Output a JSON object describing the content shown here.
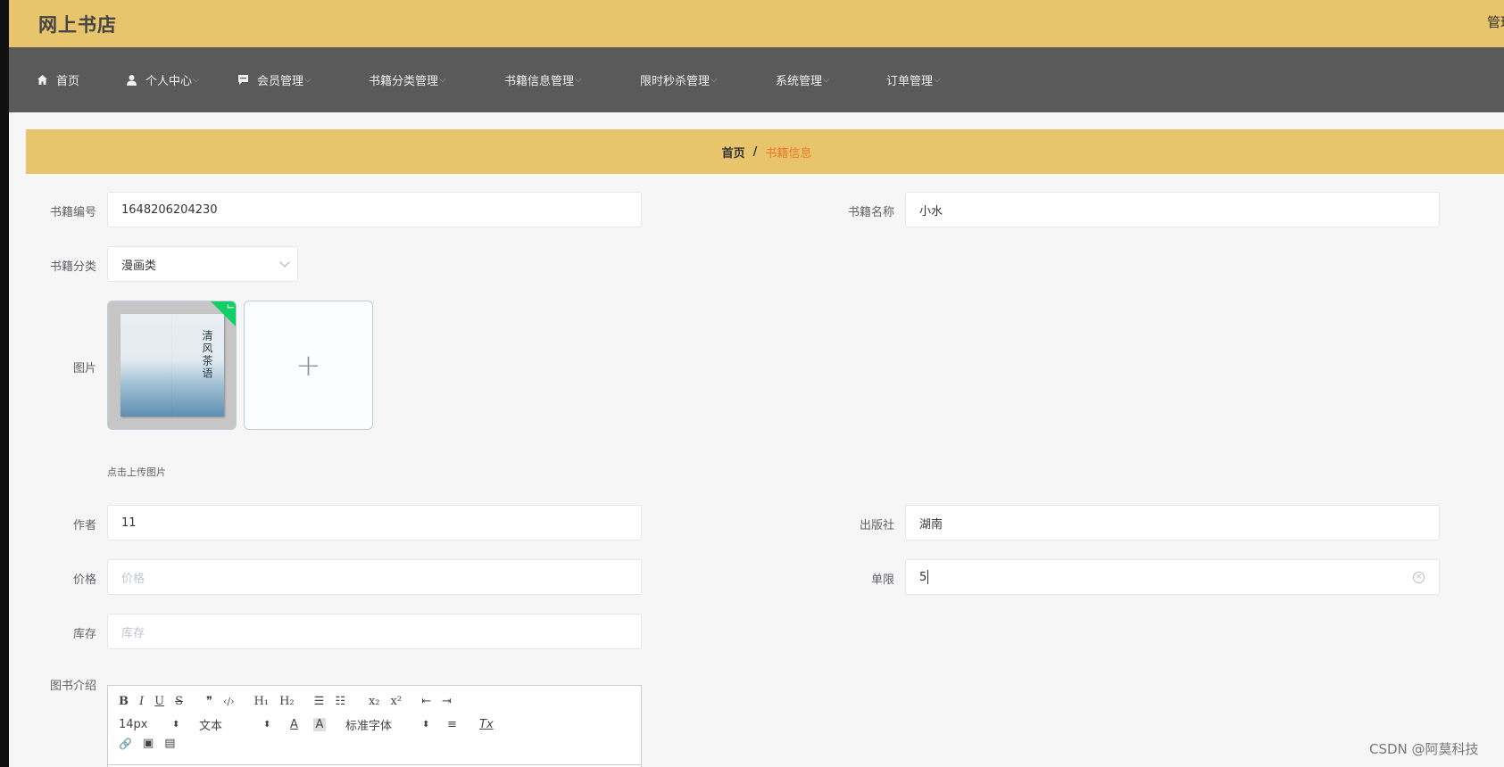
{
  "header": {
    "brand": "网上书店",
    "right_text": "管理"
  },
  "nav": [
    {
      "label": "首页",
      "icon": "home-icon",
      "chevron": ""
    },
    {
      "label": "个人中心",
      "icon": "user-icon",
      "chevron": "⌵"
    },
    {
      "label": "会员管理",
      "icon": "chat-icon",
      "chevron": "⌵"
    },
    {
      "label": "书籍分类管理",
      "icon": "grid-icon",
      "chevron": "⌵"
    },
    {
      "label": "书籍信息管理",
      "icon": "grid-icon",
      "chevron": "⌵"
    },
    {
      "label": "限时秒杀管理",
      "icon": "grid-icon",
      "chevron": "⌵"
    },
    {
      "label": "系统管理",
      "icon": "grid-icon",
      "chevron": "⌵"
    },
    {
      "label": "订单管理",
      "icon": "grid-icon",
      "chevron": "⌵"
    }
  ],
  "breadcrumb": {
    "home": "首页",
    "separator": "/",
    "current": "书籍信息"
  },
  "form": {
    "book_no": {
      "label": "书籍编号",
      "value": "1648206204230"
    },
    "book_name": {
      "label": "书籍名称",
      "value": "小水"
    },
    "category": {
      "label": "书籍分类",
      "value": "漫画类"
    },
    "image": {
      "label": "图片",
      "tip": "点击上传图片",
      "add_symbol": "+",
      "cover_title": "清风茶语"
    },
    "author": {
      "label": "作者",
      "value": "11"
    },
    "publisher": {
      "label": "出版社",
      "value": "湖南"
    },
    "price": {
      "label": "价格",
      "placeholder": "价格"
    },
    "limit": {
      "label": "单限",
      "value": "5"
    },
    "stock": {
      "label": "库存",
      "placeholder": "库存"
    },
    "intro": {
      "label": "图书介绍"
    }
  },
  "editor_toolbar": {
    "row1": [
      "B",
      "I",
      "U",
      "S",
      "❞",
      "‹/›",
      "H₁",
      "H₂",
      "☰",
      "☷",
      "x₂",
      "x²",
      "⇤",
      "⇥"
    ],
    "font_size": "14px",
    "text_type": "文本",
    "font_family": "标准字体",
    "updown": "⬍",
    "color_a": "A",
    "bg_a": "A",
    "align": "≡",
    "clear": "Tx",
    "row3": [
      "🔗",
      "▣",
      "▤"
    ]
  },
  "watermark": "CSDN @阿莫科技"
}
